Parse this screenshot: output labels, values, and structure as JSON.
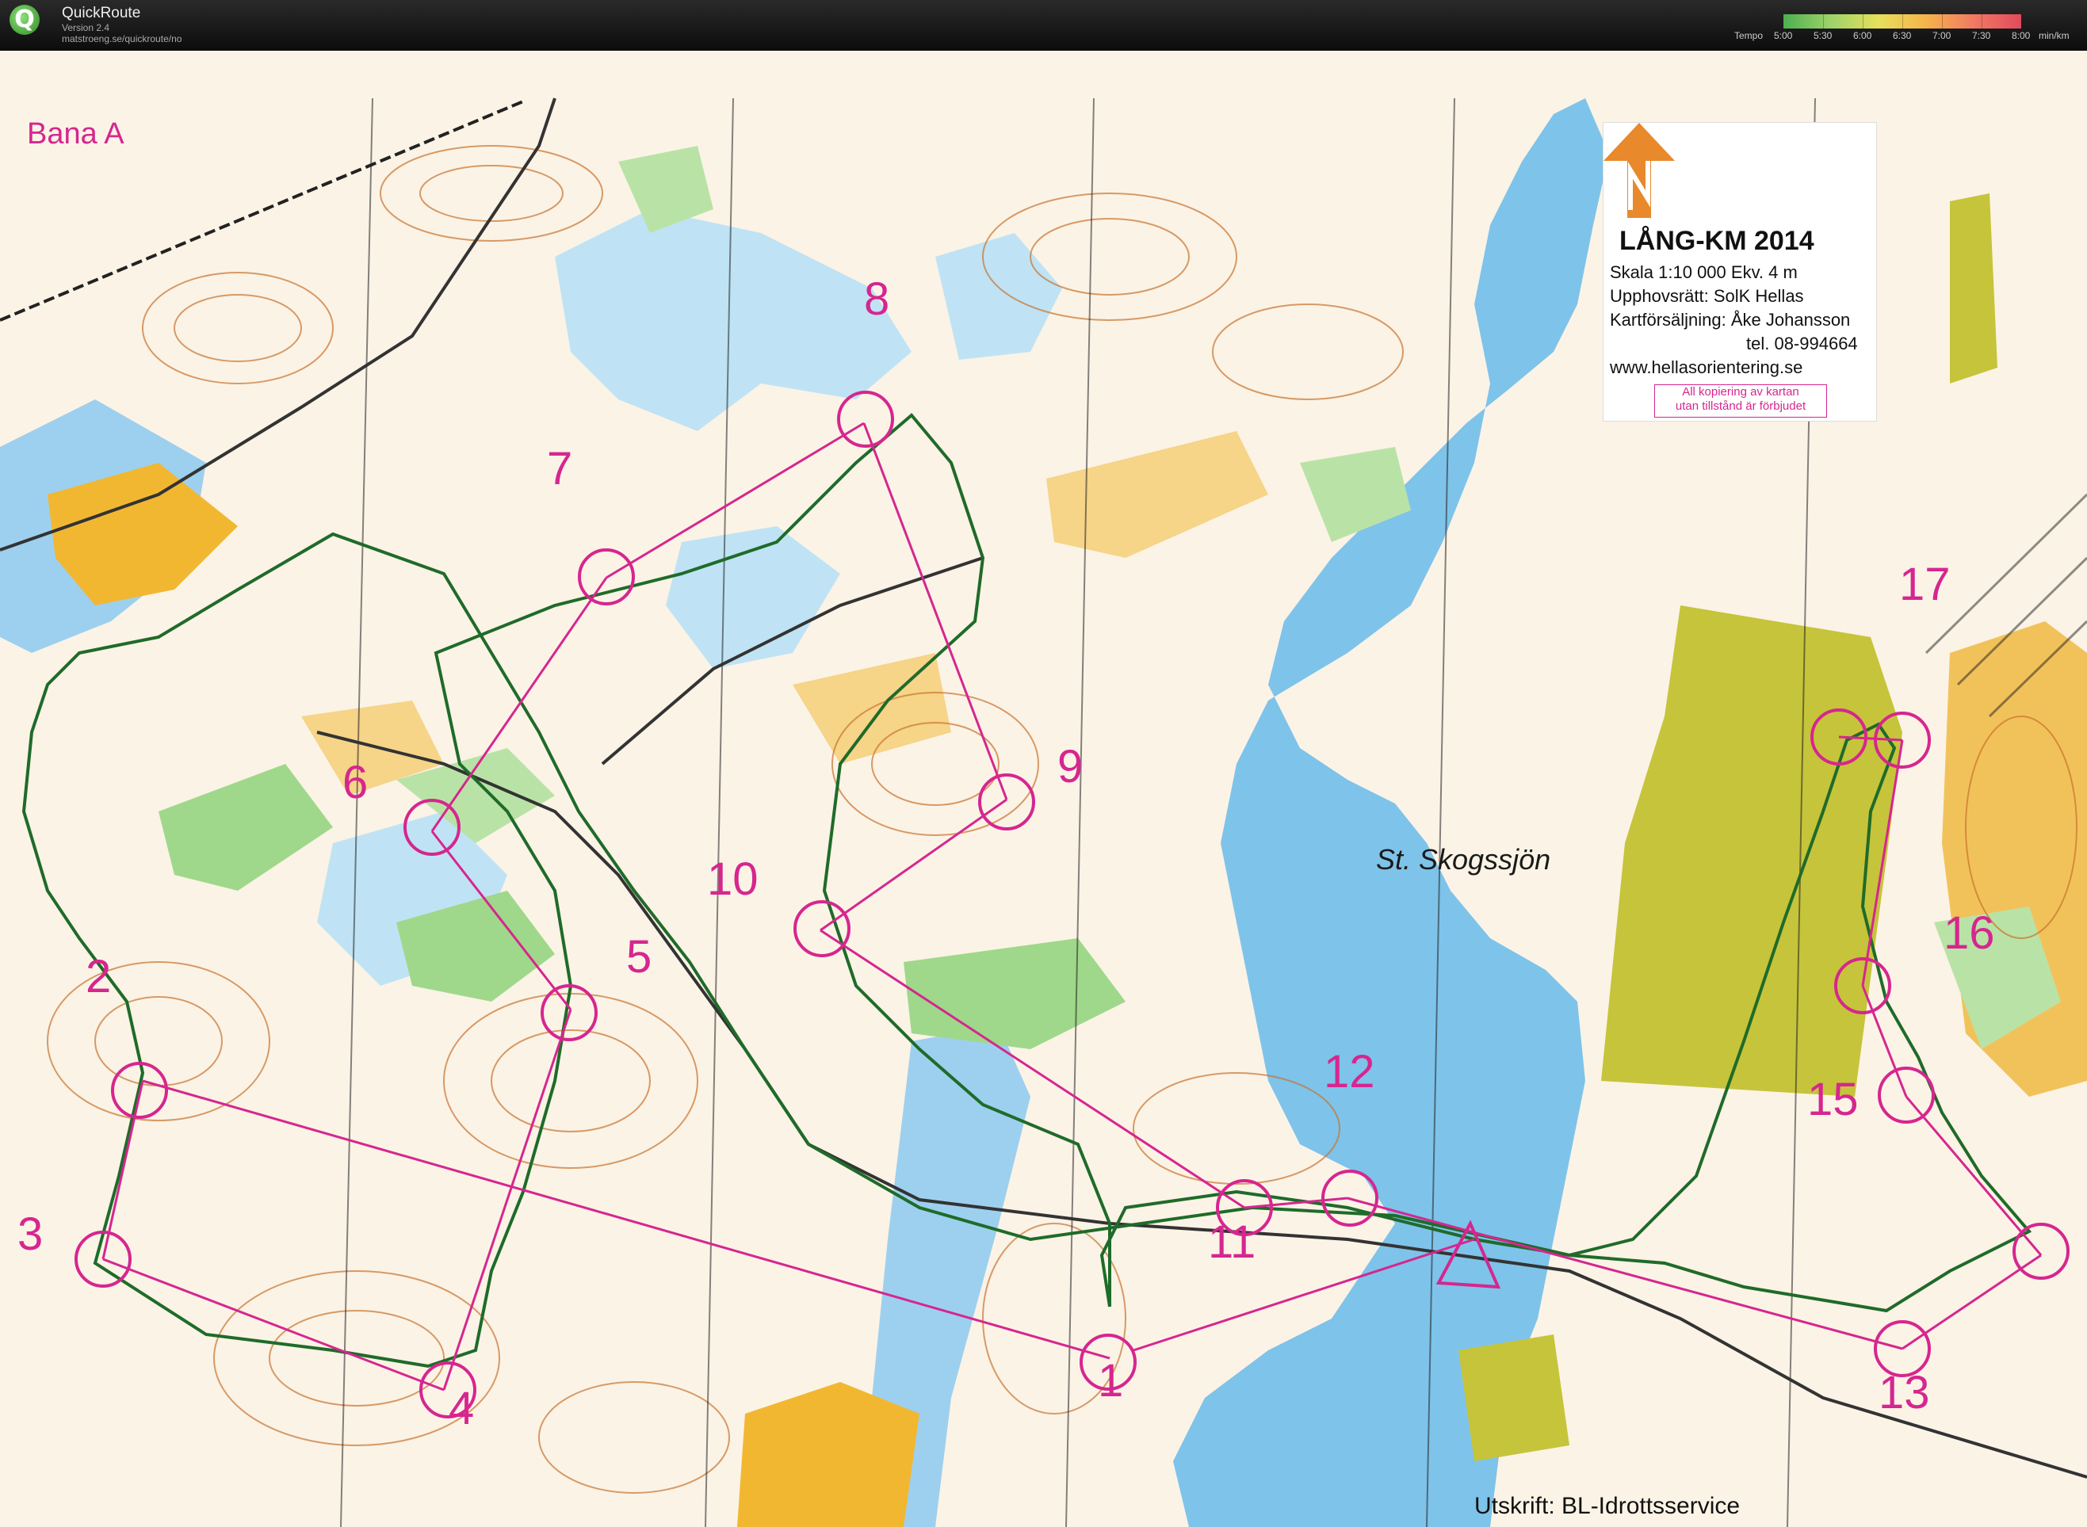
{
  "app": {
    "name": "QuickRoute",
    "version": "Version 2.4",
    "url": "matstroeng.se/quickroute/no"
  },
  "tempo": {
    "label_prefix": "Tempo",
    "labels": [
      "5:00",
      "5:30",
      "6:00",
      "6:30",
      "7:00",
      "7:30",
      "8:00"
    ],
    "unit": "min/km",
    "colors": [
      "#4caf50",
      "#9ed36a",
      "#e6e05a",
      "#f5b34c",
      "#f07a63",
      "#e24a5c"
    ]
  },
  "map": {
    "course_name": "Bana A",
    "lake_name": "St. Skogssjön",
    "print_credit": "Utskrift: BL-Idrottsservice",
    "legend": {
      "title": "LÅNG-KM 2014",
      "scale": "Skala 1:10 000  Ekv. 4 m",
      "copyright": "Upphovsrätt: SolK Hellas",
      "sales": "Kartförsäljning: Åke Johansson",
      "phone": "tel. 08-994664",
      "web": "www.hellasorientering.se",
      "warning_line1": "All kopiering av kartan",
      "warning_line2": "utan tillstånd är förbjudet"
    },
    "colors": {
      "course": "#d6268f",
      "route": "#1f6b2a",
      "water": "#7ec3ea",
      "open_land": "#f2b731",
      "vegetation": "#9fd88a",
      "contour": "#c8742f",
      "background": "#fbf3e6"
    },
    "controls": [
      "1",
      "2",
      "3",
      "4",
      "5",
      "6",
      "7",
      "8",
      "9",
      "10",
      "11",
      "12",
      "13",
      "15",
      "16",
      "17"
    ]
  }
}
